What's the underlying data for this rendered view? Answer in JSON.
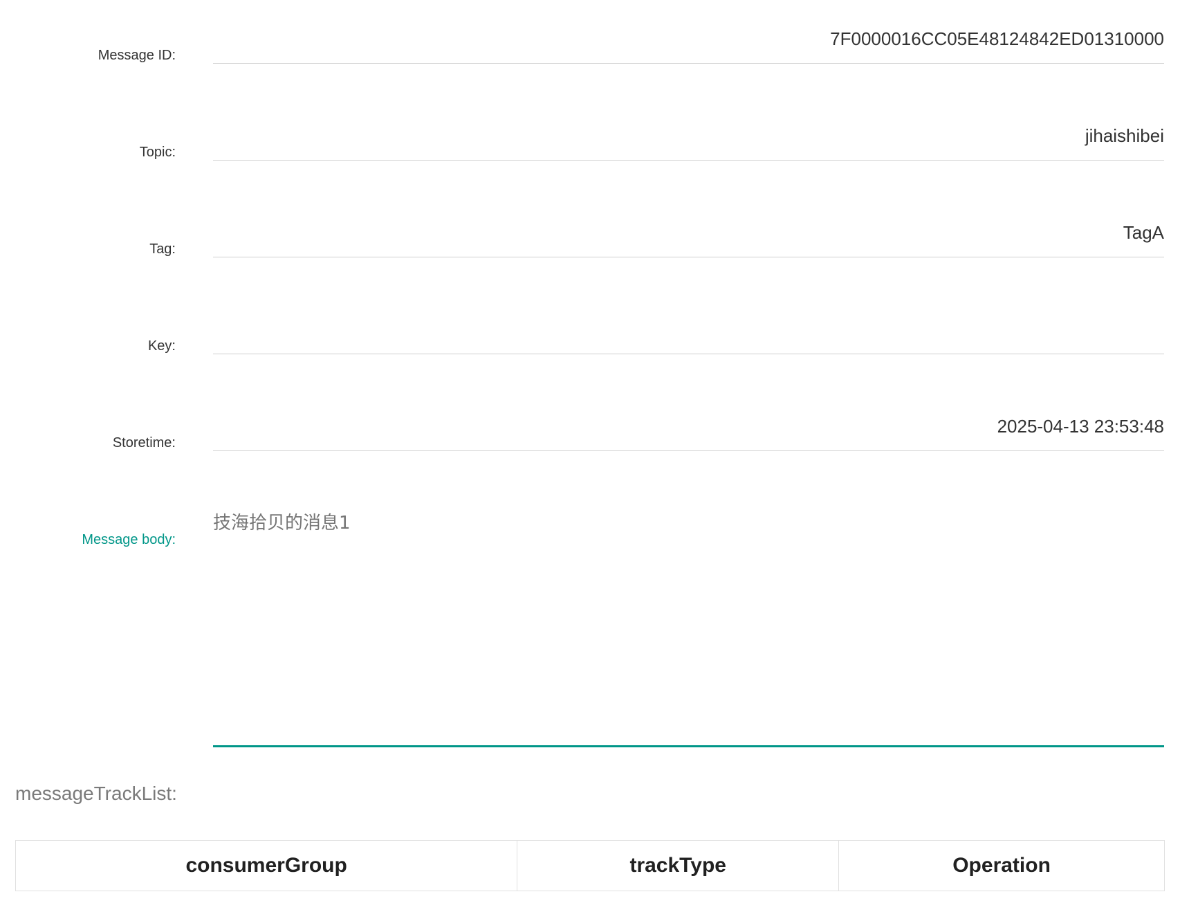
{
  "form": {
    "fields": [
      {
        "label": "Message ID:",
        "value": "7F0000016CC05E48124842ED01310000"
      },
      {
        "label": "Topic:",
        "value": "jihaishibei"
      },
      {
        "label": "Tag:",
        "value": "TagA"
      },
      {
        "label": "Key:",
        "value": ""
      },
      {
        "label": "Storetime:",
        "value": "2025-04-13 23:53:48"
      }
    ],
    "message_body": {
      "label": "Message body:",
      "value": "技海拾贝的消息1"
    }
  },
  "track": {
    "title": "messageTrackList:",
    "columns": [
      "consumerGroup",
      "trackType",
      "Operation"
    ]
  },
  "colors": {
    "accent": "#009688",
    "divider": "#cfcfcf"
  }
}
